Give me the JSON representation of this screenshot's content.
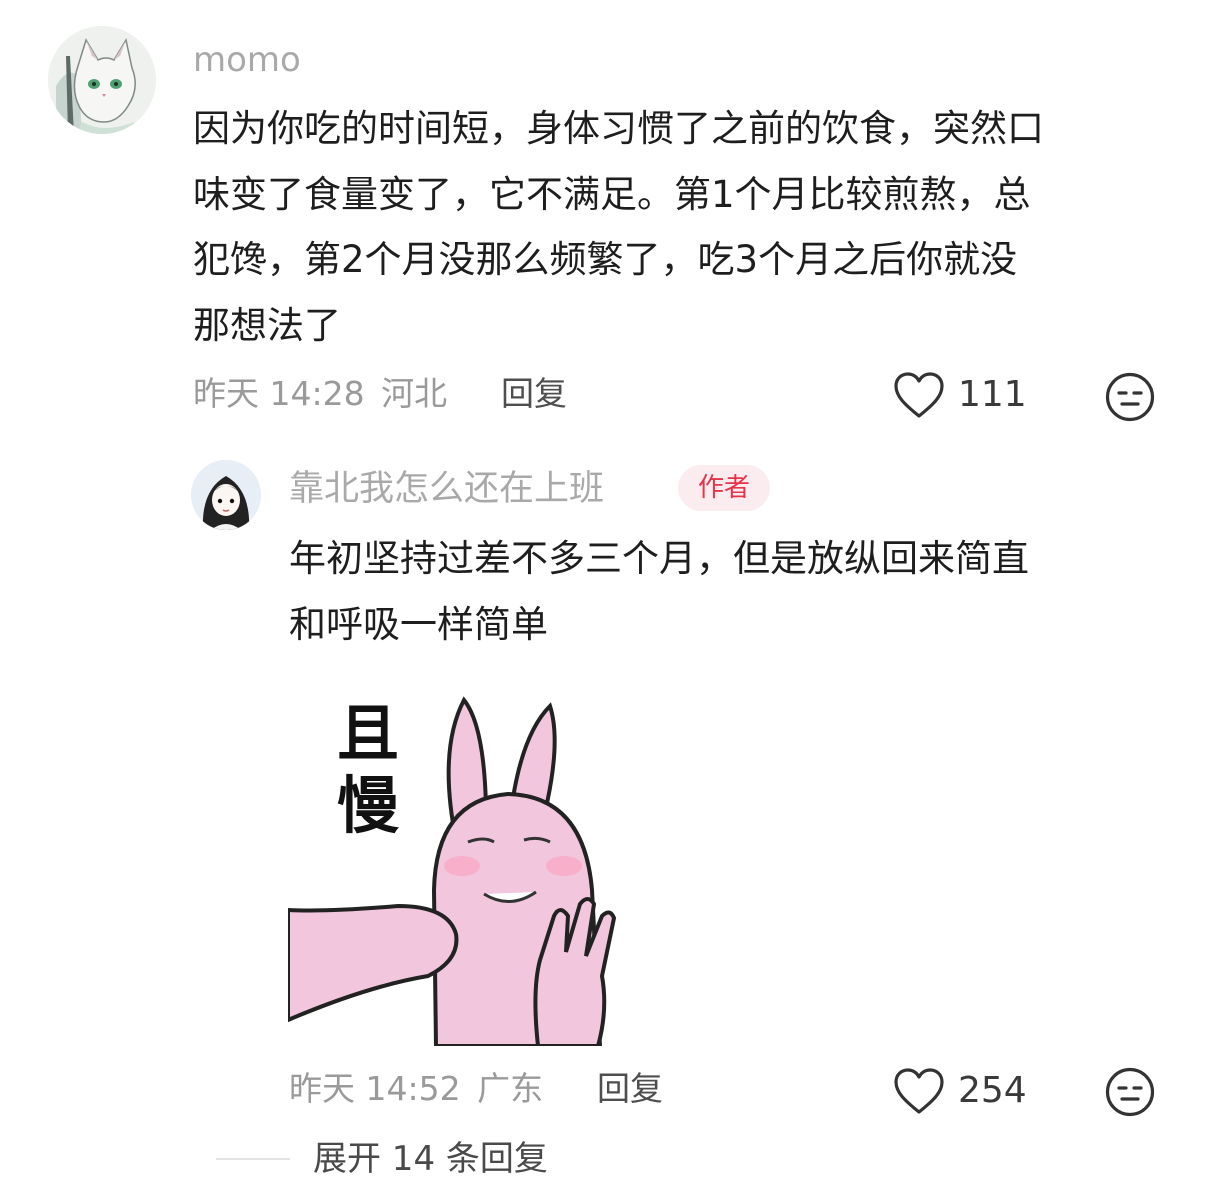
{
  "comment": {
    "username": "momo",
    "avatar_icon": "cat-avatar-icon",
    "text_lines": [
      "因为你吃的时间短，身体习惯了之前的饮食，突然口",
      "味变了食量变了，它不满足。第1个月比较煎熬，总",
      "犯馋，第2个月没那么频繁了，吃3个月之后你就没",
      "那想法了"
    ],
    "time": "昨天 14:28",
    "location": "河北",
    "reply_label": "回复",
    "like_count": "111",
    "like_icon": "heart-outline-icon",
    "emoji_icon": "face-emoji-icon"
  },
  "reply": {
    "username": "靠北我怎么还在上班",
    "badge": "作者",
    "avatar_icon": "girl-avatar-icon",
    "text_lines": [
      "年初坚持过差不多三个月，但是放纵回来简直",
      "和呼吸一样简单"
    ],
    "sticker": {
      "caption_lines": [
        "且",
        "慢"
      ],
      "icon": "pink-rabbit-sticker-icon"
    },
    "time": "昨天 14:52",
    "location": "广东",
    "reply_label": "回复",
    "like_count": "254",
    "like_icon": "heart-outline-icon",
    "emoji_icon": "face-emoji-icon"
  },
  "expand": {
    "label": "展开 14 条回复"
  },
  "colors": {
    "username": "#a9a9a9",
    "meta": "#9a9a9a",
    "badge_bg": "#fbecef",
    "badge_text": "#e5344a",
    "sticker_pink": "#f2c6dd"
  }
}
